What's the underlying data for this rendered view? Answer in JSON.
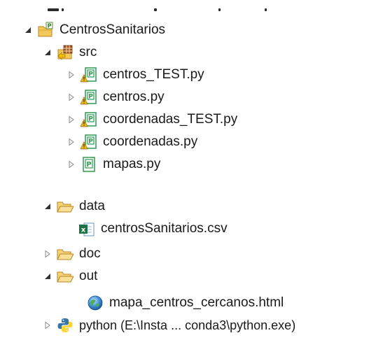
{
  "tree": {
    "project": {
      "label": "CentrosSanitarios"
    },
    "src": {
      "label": "src",
      "files": [
        {
          "label": "centros_TEST.py",
          "warning": true
        },
        {
          "label": "centros.py",
          "warning": true
        },
        {
          "label": "coordenadas_TEST.py",
          "warning": true
        },
        {
          "label": "coordenadas.py",
          "warning": true
        },
        {
          "label": "mapas.py",
          "warning": false
        }
      ]
    },
    "data": {
      "label": "data",
      "files": [
        {
          "label": "centrosSanitarios.csv"
        }
      ]
    },
    "doc": {
      "label": "doc"
    },
    "out": {
      "label": "out",
      "files": [
        {
          "label": "mapa_centros_cercanos.html"
        }
      ]
    },
    "interpreter": {
      "label": "python  (E:\\Insta ... conda3\\python.exe)"
    }
  },
  "icons": {
    "project": "python-project-folder-icon",
    "source_folder": "source-folder-icon",
    "python_file": "python-file-icon",
    "warning_overlay": "warning-overlay-icon",
    "folder": "folder-icon",
    "csv_file": "excel-csv-file-icon",
    "html_file": "globe-html-file-icon",
    "interpreter": "python-interpreter-icon"
  },
  "colors": {
    "folder": "#f2c85b",
    "python_file": "#2e9a52",
    "warning": "#f6c000",
    "excel": "#1e7145",
    "text": "#1a1a1a",
    "twisty": "#555555"
  }
}
